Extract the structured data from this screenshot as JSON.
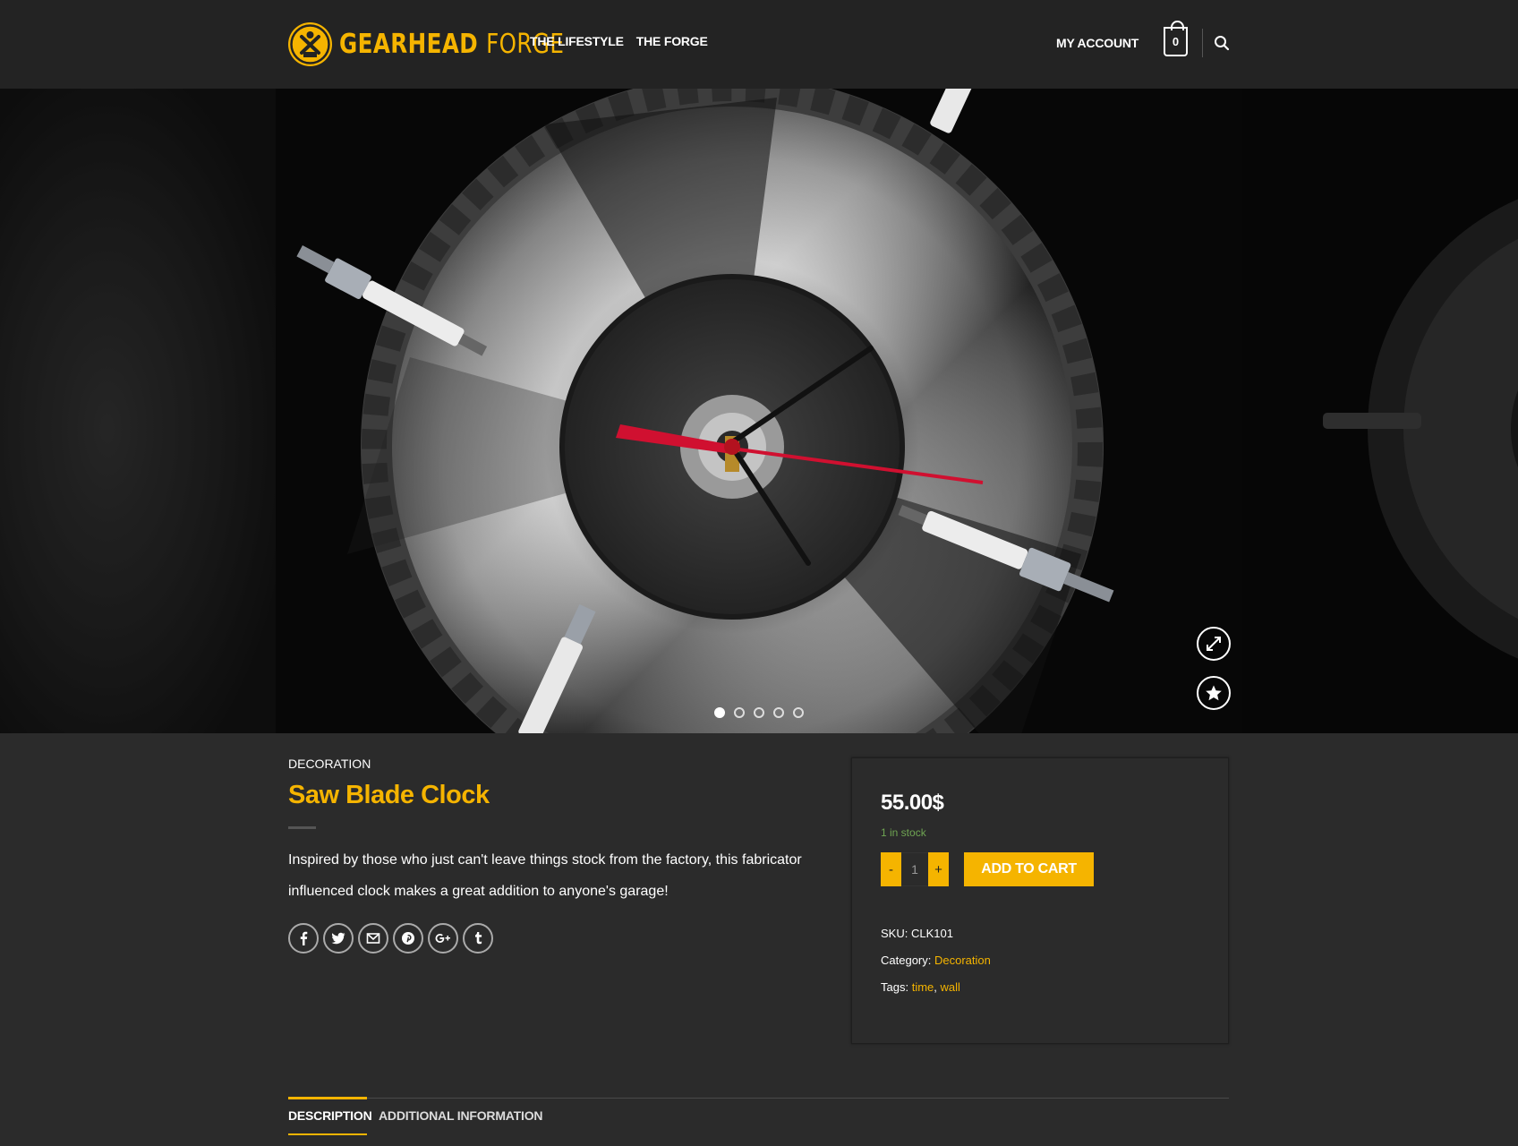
{
  "brand": {
    "name_part1": "GEARHEAD",
    "name_part2": "FORGE",
    "color": "#f5b400"
  },
  "nav": {
    "items": [
      {
        "label": "THE LIFESTYLE"
      },
      {
        "label": "THE FORGE"
      }
    ]
  },
  "header": {
    "account_label": "MY ACCOUNT",
    "cart_count": "0",
    "search_icon": "search-icon"
  },
  "gallery": {
    "slide_count": 5,
    "active_slide": 1,
    "zoom_icon": "expand-icon",
    "wishlist_icon": "star-icon"
  },
  "product": {
    "category": "DECORATION",
    "title": "Saw Blade Clock",
    "description": "Inspired by those who just can't leave things stock from the factory, this fabricator influenced clock makes a great addition to anyone's garage!",
    "price": "55.00$",
    "stock": "1 in stock",
    "quantity": "1",
    "qty_minus": "-",
    "qty_plus": "+",
    "add_to_cart": "ADD TO CART",
    "sku_label": "SKU:",
    "sku": "CLK101",
    "category_label": "Category:",
    "category_link": "Decoration",
    "tags_label": "Tags:",
    "tag1": "time",
    "tag_sep": ",",
    "tag2": "wall"
  },
  "share": {
    "icons": [
      "facebook-icon",
      "twitter-icon",
      "email-icon",
      "pinterest-icon",
      "google-plus-icon",
      "tumblr-icon"
    ]
  },
  "tabs": [
    {
      "label": "DESCRIPTION",
      "active": true
    },
    {
      "label": "ADDITIONAL INFORMATION",
      "active": false
    }
  ],
  "colors": {
    "accent": "#f5b400",
    "background": "#2b2b2b",
    "header": "#232323",
    "stock": "#6fa552"
  }
}
